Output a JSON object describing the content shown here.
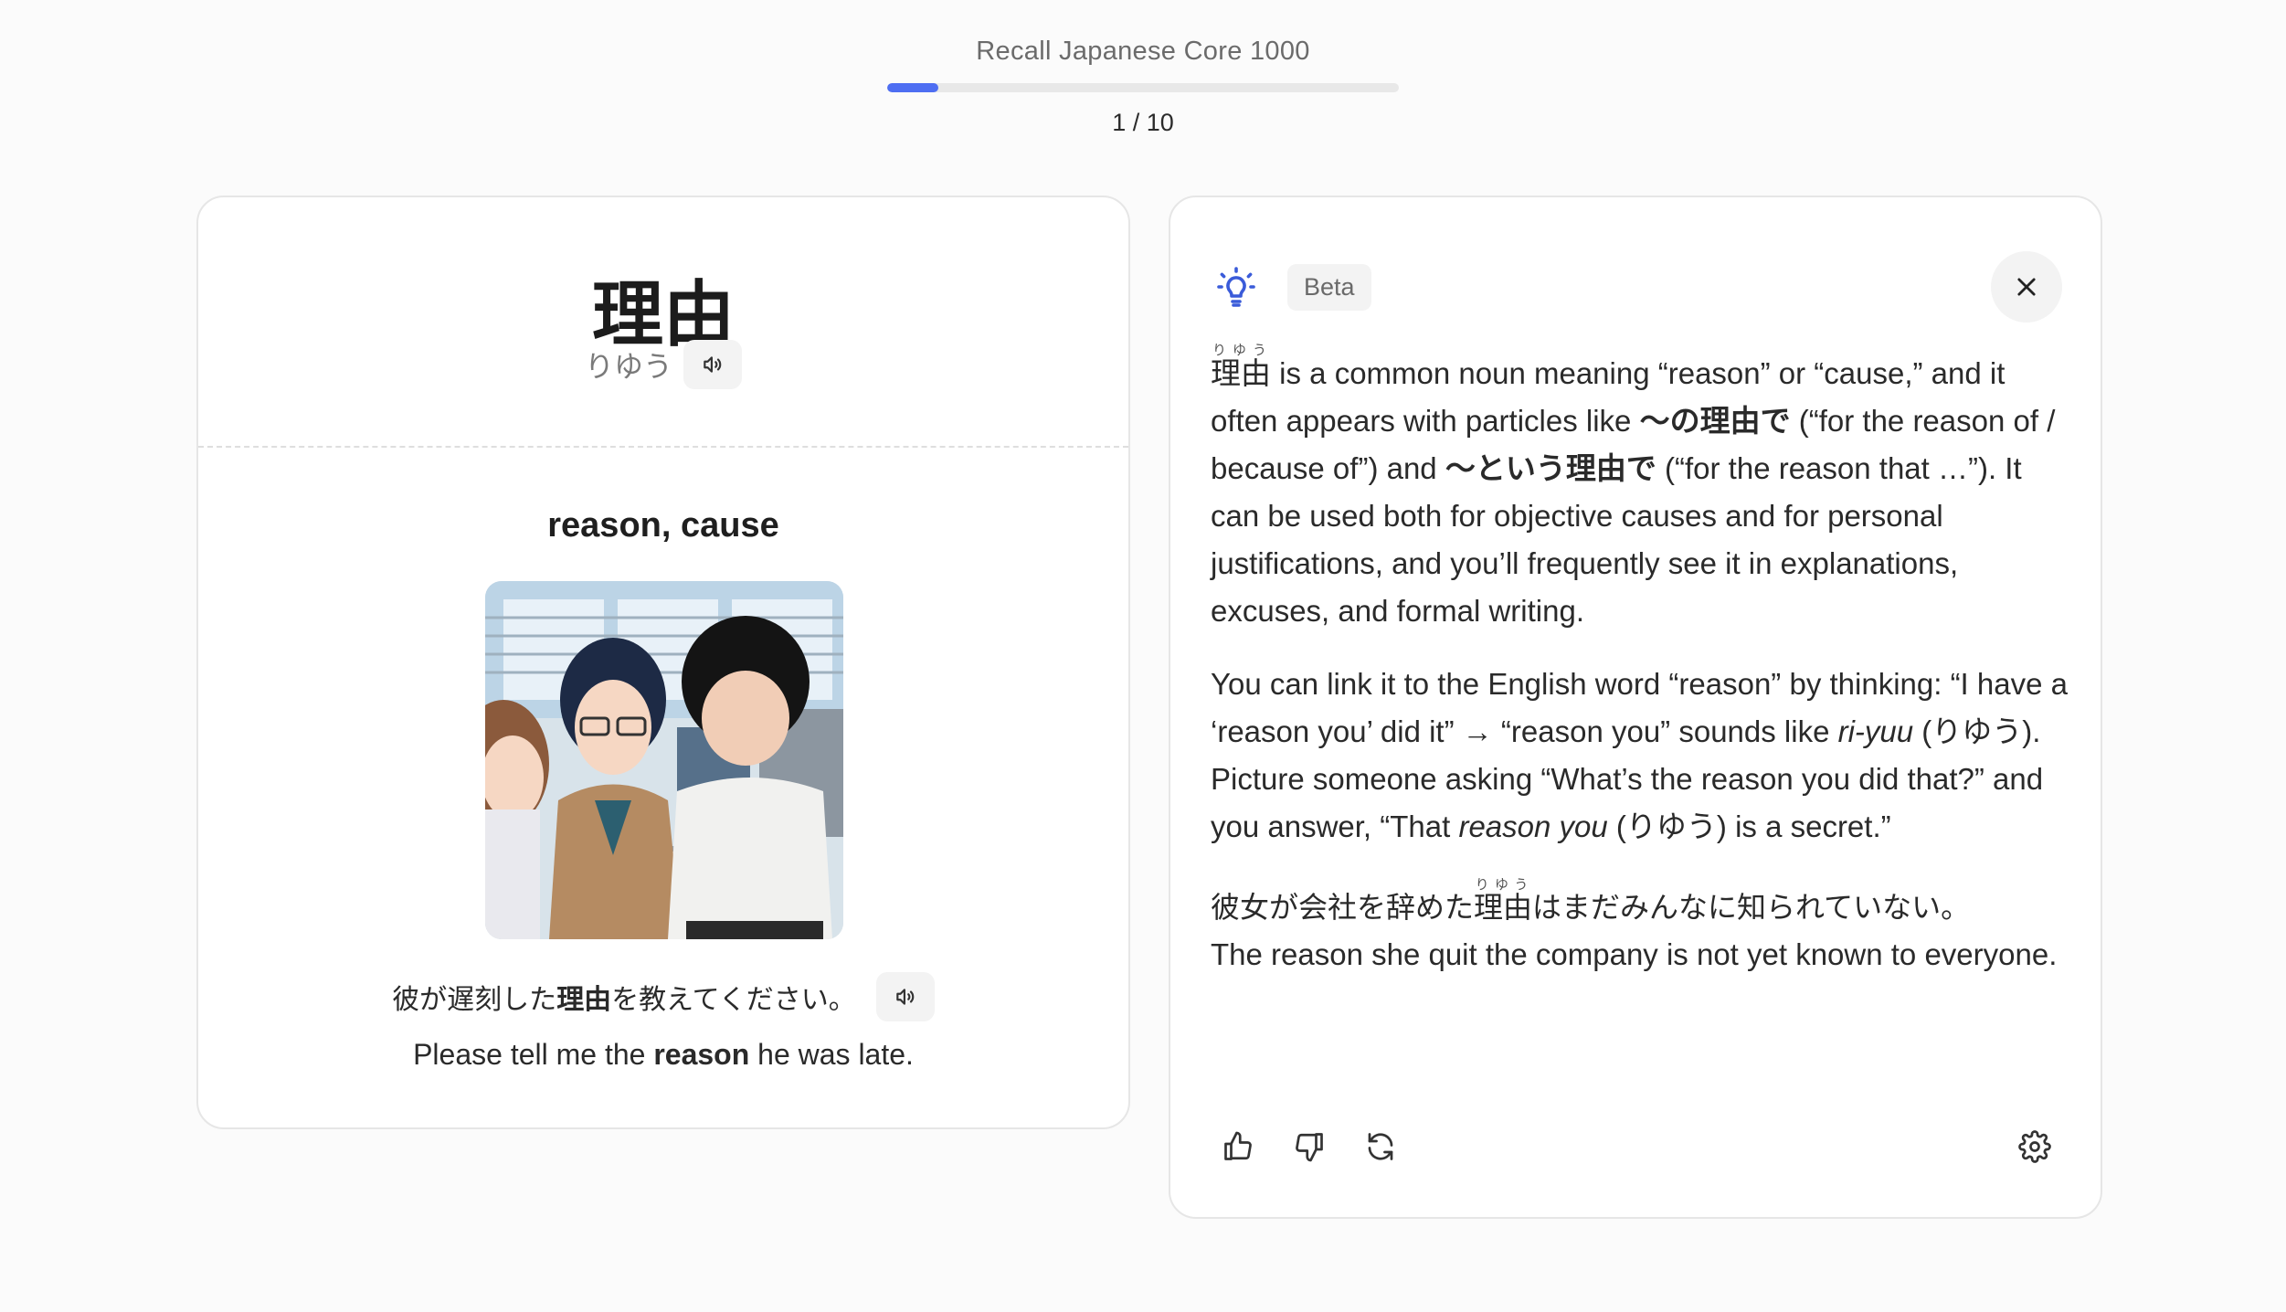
{
  "header": {
    "deck_title": "Recall Japanese Core 1000",
    "progress_fraction": 0.1,
    "progress_label": "1 / 10"
  },
  "card": {
    "word": "理由",
    "reading": "りゆう",
    "meaning": "reason, cause",
    "illustration_icon": "anime-office-scene-image",
    "example_jp_before": "彼が遅刻した",
    "example_jp_highlight": "理由",
    "example_jp_after": "を教えてください。",
    "example_en_before": "Please tell me the ",
    "example_en_highlight": "reason",
    "example_en_after": " he was late."
  },
  "explanation": {
    "badge": "Beta",
    "icons": {
      "hint": "lightbulb-icon",
      "close": "close-icon",
      "like": "thumbs-up-icon",
      "dislike": "thumbs-down-icon",
      "regenerate": "refresh-icon",
      "settings": "gear-icon"
    },
    "accent_color": "#3a5bd9",
    "p1": {
      "word": "理由",
      "ruby": "りゆう",
      "t1": " is a common noun meaning “reason” or “cause,” and it often appears with particles like ",
      "b1": "〜の理由で",
      "t2": " (“for the reason of / because of”) and ",
      "b2": "〜という理由で",
      "t3": " (“for the reason that …”). It can be used both for objective causes and for personal justifications, and you’ll frequently see it in explanations, excuses, and formal writing."
    },
    "p2": {
      "t1": "You can link it to the English word “reason” by thinking: “I have a ‘reason you’ did it” → “reason you” sounds like ",
      "i1": "ri-yuu",
      "t2": " (りゆう). Picture someone asking “What’s the reason you did that?” and you answer, “That ",
      "i2": "reason you",
      "t3": " (りゆう) is a secret.”"
    },
    "p3": {
      "jp_before": "彼女が会社を辞めた",
      "jp_word": "理由",
      "jp_ruby": "りゆう",
      "jp_after": "はまだみんなに知られていない。",
      "en": "The reason she quit the company is not yet known to everyone."
    }
  }
}
